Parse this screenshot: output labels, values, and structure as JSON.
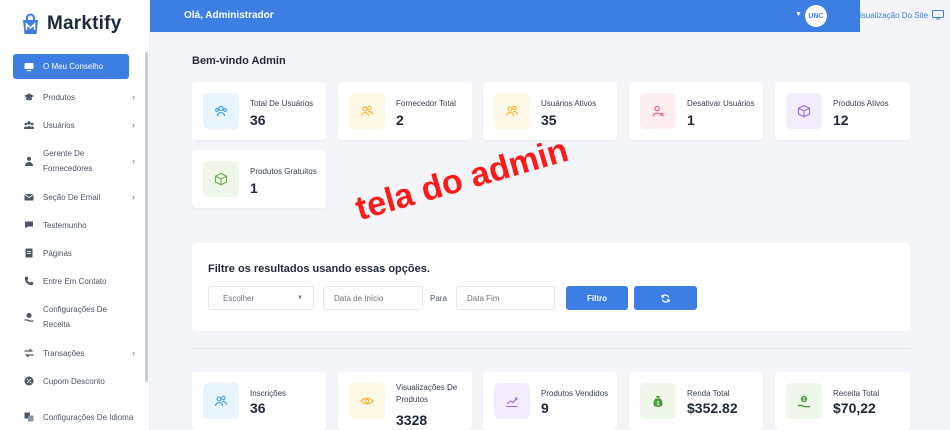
{
  "app": {
    "name": "Marktify"
  },
  "sidebar": {
    "items": [
      {
        "label": "O Meu Conselho",
        "icon": "monitor-icon",
        "active": true,
        "chevron": false
      },
      {
        "label": "Produtos",
        "icon": "graduation-cap-icon",
        "active": false,
        "chevron": true
      },
      {
        "label": "Usuários",
        "icon": "users-icon",
        "active": false,
        "chevron": true
      },
      {
        "label": "Gerente De Fornecedores",
        "icon": "user-tie-icon",
        "active": false,
        "chevron": true
      },
      {
        "label": "Seção De Email",
        "icon": "envelope-icon",
        "active": false,
        "chevron": true
      },
      {
        "label": "Testemunho",
        "icon": "comment-icon",
        "active": false,
        "chevron": false
      },
      {
        "label": "Páginas",
        "icon": "page-icon",
        "active": false,
        "chevron": false
      },
      {
        "label": "Entre Em Contato",
        "icon": "phone-icon",
        "active": false,
        "chevron": false
      },
      {
        "label": "Configurações De Receita",
        "icon": "hand-dollar-icon",
        "active": false,
        "chevron": false
      },
      {
        "label": "Transações",
        "icon": "exchange-icon",
        "active": false,
        "chevron": true
      },
      {
        "label": "Cupom Desconto",
        "icon": "coupon-icon",
        "active": false,
        "chevron": false
      },
      {
        "label": "Configurações De Idioma",
        "icon": "language-icon",
        "active": false,
        "chevron": false
      }
    ]
  },
  "header": {
    "greeting": "Olá, Administrador",
    "avatar_text": "UNC",
    "site_link": "isualização Do Site"
  },
  "main": {
    "title": "Bem-vindo Admin",
    "stats": [
      {
        "label": "Total De Usuários",
        "value": "36",
        "icon": "users-icon",
        "bg": "#e8f4fe",
        "color": "#3b9ae1"
      },
      {
        "label": "Fornecedor Total",
        "value": "2",
        "icon": "user-group-icon",
        "bg": "#fff8e6",
        "color": "#f5b325"
      },
      {
        "label": "Usuários Ativos",
        "value": "35",
        "icon": "user-group-icon",
        "bg": "#fff8e6",
        "color": "#f5b325"
      },
      {
        "label": "Desativar Usuários",
        "value": "1",
        "icon": "user-x-icon",
        "bg": "#fdeef0",
        "color": "#ee5a76"
      },
      {
        "label": "Produtos Ativos",
        "value": "12",
        "icon": "box-icon",
        "bg": "#f2ecfc",
        "color": "#9b6bdc"
      },
      {
        "label": "Produtos Gratuitos",
        "value": "1",
        "icon": "box-icon",
        "bg": "#eef7ea",
        "color": "#6cae4f"
      }
    ],
    "filter": {
      "title": "Filtre os resultados usando essas opções.",
      "select_value": "Escolher",
      "start_placeholder": "Data de Início",
      "to_label": "Para",
      "end_placeholder": "Data Fim",
      "filter_button": "Filtro",
      "refresh_icon": "refresh-icon"
    },
    "sales": [
      {
        "label": "Inscrições",
        "value": "36",
        "icon": "user-group-icon",
        "bg": "#e8f4fe",
        "color": "#3b9ae1"
      },
      {
        "label": "Visualizações De Produtos",
        "value": "3328",
        "icon": "eye-icon",
        "bg": "#fff8e6",
        "color": "#f5b325"
      },
      {
        "label": "Produtos Vendidos",
        "value": "9",
        "icon": "chart-icon",
        "bg": "#f2ecfc",
        "color": "#9b6bdc"
      },
      {
        "label": "Renda Total",
        "value": "$352.82",
        "icon": "money-bag-icon",
        "bg": "#eef7ea",
        "color": "#4a9a3a"
      },
      {
        "label": "Receita Total",
        "value": "$70,22",
        "icon": "hand-dollar-icon",
        "bg": "#eef7ea",
        "color": "#4a9a3a"
      }
    ]
  },
  "annotation": {
    "text": "tela do admin",
    "color": "#ff1a1a"
  }
}
